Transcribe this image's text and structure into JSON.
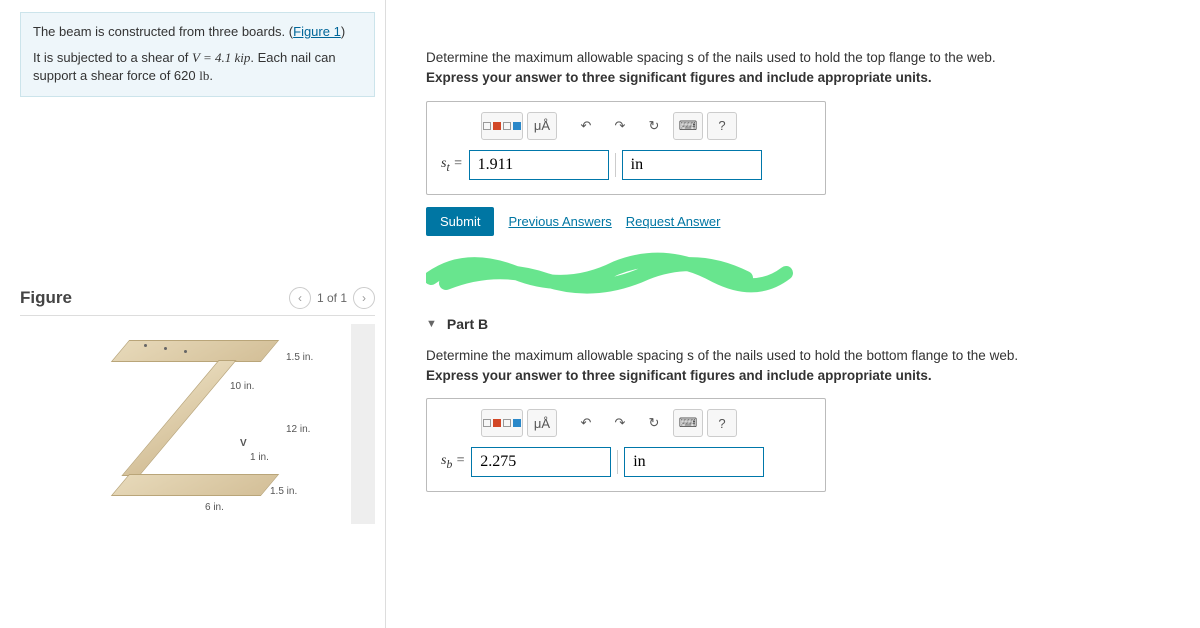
{
  "prompt": {
    "line1_a": "The beam is constructed from three boards. (",
    "figure_link": "Figure 1",
    "line1_b": ")",
    "line2_a": "It is subjected to a shear of ",
    "V_eq": "V = 4.1 kip",
    "line2_b": ". Each nail can support a shear force of 620 ",
    "unit": "lb",
    "line2_c": "."
  },
  "figure": {
    "heading": "Figure",
    "pager": "1 of 1",
    "dims": {
      "top_flange_t": "1.5 in.",
      "top_flange_w": "10 in.",
      "web_h": "12 in.",
      "web_t": "1 in.",
      "bot_flange_t": "1.5 in.",
      "bot_flange_w": "6 in.",
      "shear_label": "V"
    }
  },
  "partA": {
    "q": "Determine the maximum allowable spacing s of the nails used to hold the top flange to the web.",
    "inst": "Express your answer to three significant figures and include appropriate units.",
    "var_label": "sₜ =",
    "value": "1.911",
    "unit": "in",
    "toolbar": {
      "units": "μÅ",
      "help": "?"
    },
    "submit": "Submit",
    "prev": "Previous Answers",
    "request": "Request Answer"
  },
  "partB": {
    "header": "Part B",
    "q": "Determine the maximum allowable spacing s of the nails used to hold the bottom flange to the web.",
    "inst": "Express your answer to three significant figures and include appropriate units.",
    "var_label": "s_b =",
    "value": "2.275",
    "unit": "in",
    "toolbar": {
      "units": "μÅ",
      "help": "?"
    }
  }
}
